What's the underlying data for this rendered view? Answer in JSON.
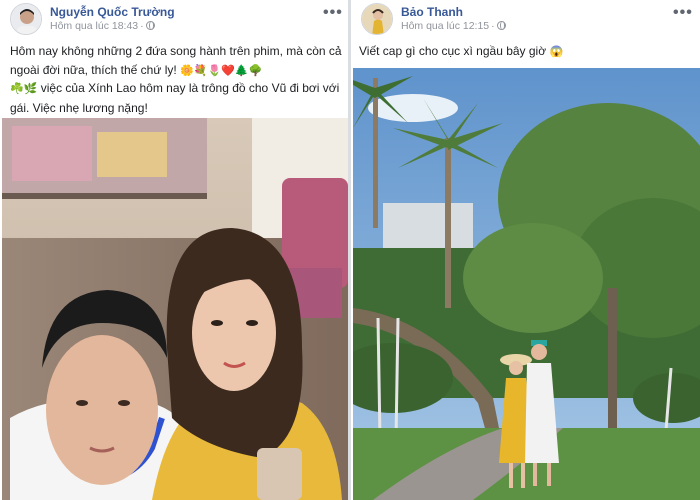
{
  "posts": [
    {
      "author": "Nguyễn Quốc Trường",
      "time": "Hôm qua lúc 18:43",
      "more": "•••",
      "text_line1": "Hôm nay không những 2 đứa song hành trên phim, mà còn cả ngoài đời nữa, thích thế chứ ly!",
      "text_line1_emoji": "🌼💐🌷❤️🌲🌳",
      "text_line2_emoji": "☘️🌿",
      "text_line2": "việc của Xính Lao hôm nay là trông đồ cho Vũ đi bơi với gái. Việc nhẹ lương nặng!"
    },
    {
      "author": "Bảo Thanh",
      "time": "Hôm qua lúc 12:15",
      "more": "•••",
      "text_line1": "Viết cap gì cho cục xì ngầu bây giờ",
      "text_line1_emoji": "😱"
    }
  ],
  "colors": {
    "author": "#385898",
    "meta": "#90949c",
    "text": "#1c1e21",
    "divider": "#dadde1"
  },
  "icons": [
    "globe-icon",
    "more-options-icon",
    "avatar"
  ]
}
